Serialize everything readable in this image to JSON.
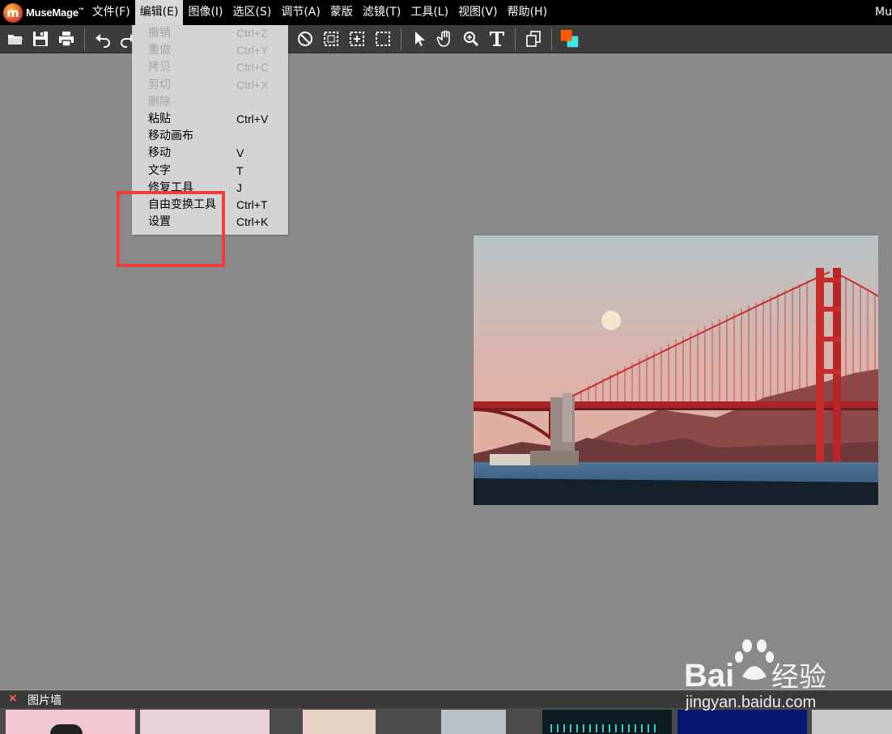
{
  "app": {
    "name": "MuseMage",
    "trademark": "™",
    "title_right": "Mu"
  },
  "menubar": {
    "items": [
      {
        "id": "file",
        "label": "文件(F)"
      },
      {
        "id": "edit",
        "label": "编辑(E)",
        "active": true
      },
      {
        "id": "image",
        "label": "图像(I)"
      },
      {
        "id": "select",
        "label": "选区(S)"
      },
      {
        "id": "adjust",
        "label": "调节(A)"
      },
      {
        "id": "mask",
        "label": "蒙版"
      },
      {
        "id": "filter",
        "label": "滤镜(T)"
      },
      {
        "id": "tools",
        "label": "工具(L)"
      },
      {
        "id": "view",
        "label": "视图(V)"
      },
      {
        "id": "help",
        "label": "帮助(H)"
      }
    ]
  },
  "toolbar": {
    "icons": [
      "folder-open-icon",
      "save-icon",
      "print-icon",
      "undo-icon",
      "redo-icon",
      "deselect-icon",
      "marquee-icon",
      "center-select-icon",
      "dashed-select-icon",
      "pointer-icon",
      "hand-icon",
      "zoom-icon",
      "text-tool-icon",
      "layers-icon",
      "color-swatch-icon"
    ],
    "colors": {
      "foreground": "#ff5a00",
      "background": "#3fe6e6"
    }
  },
  "edit_menu": {
    "items": [
      {
        "label": "撤销",
        "shortcut": "Ctrl+Z",
        "disabled": true
      },
      {
        "label": "重做",
        "shortcut": "Ctrl+Y",
        "disabled": true
      },
      {
        "label": "拷贝",
        "shortcut": "Ctrl+C",
        "disabled": true
      },
      {
        "label": "剪切",
        "shortcut": "Ctrl+X",
        "disabled": true
      },
      {
        "label": "删除",
        "shortcut": "",
        "disabled": true
      },
      {
        "label": "粘贴",
        "shortcut": "Ctrl+V",
        "disabled": false
      },
      {
        "label": "移动画布",
        "shortcut": "",
        "disabled": false
      },
      {
        "label": "移动",
        "shortcut": "V",
        "disabled": false
      },
      {
        "label": "文字",
        "shortcut": "T",
        "disabled": false
      },
      {
        "label": "修复工具",
        "shortcut": "J",
        "disabled": false
      },
      {
        "label": "自由变换工具",
        "shortcut": "Ctrl+T",
        "disabled": false
      },
      {
        "label": "设置",
        "shortcut": "Ctrl+K",
        "disabled": false
      }
    ]
  },
  "highlight_color": "#ef3e3e",
  "bottom_panel": {
    "close_glyph": "×",
    "title": "图片墙"
  },
  "watermark": {
    "brand_left": "Bai",
    "brand_right": "经验",
    "url": "jingyan.baidu.com"
  }
}
